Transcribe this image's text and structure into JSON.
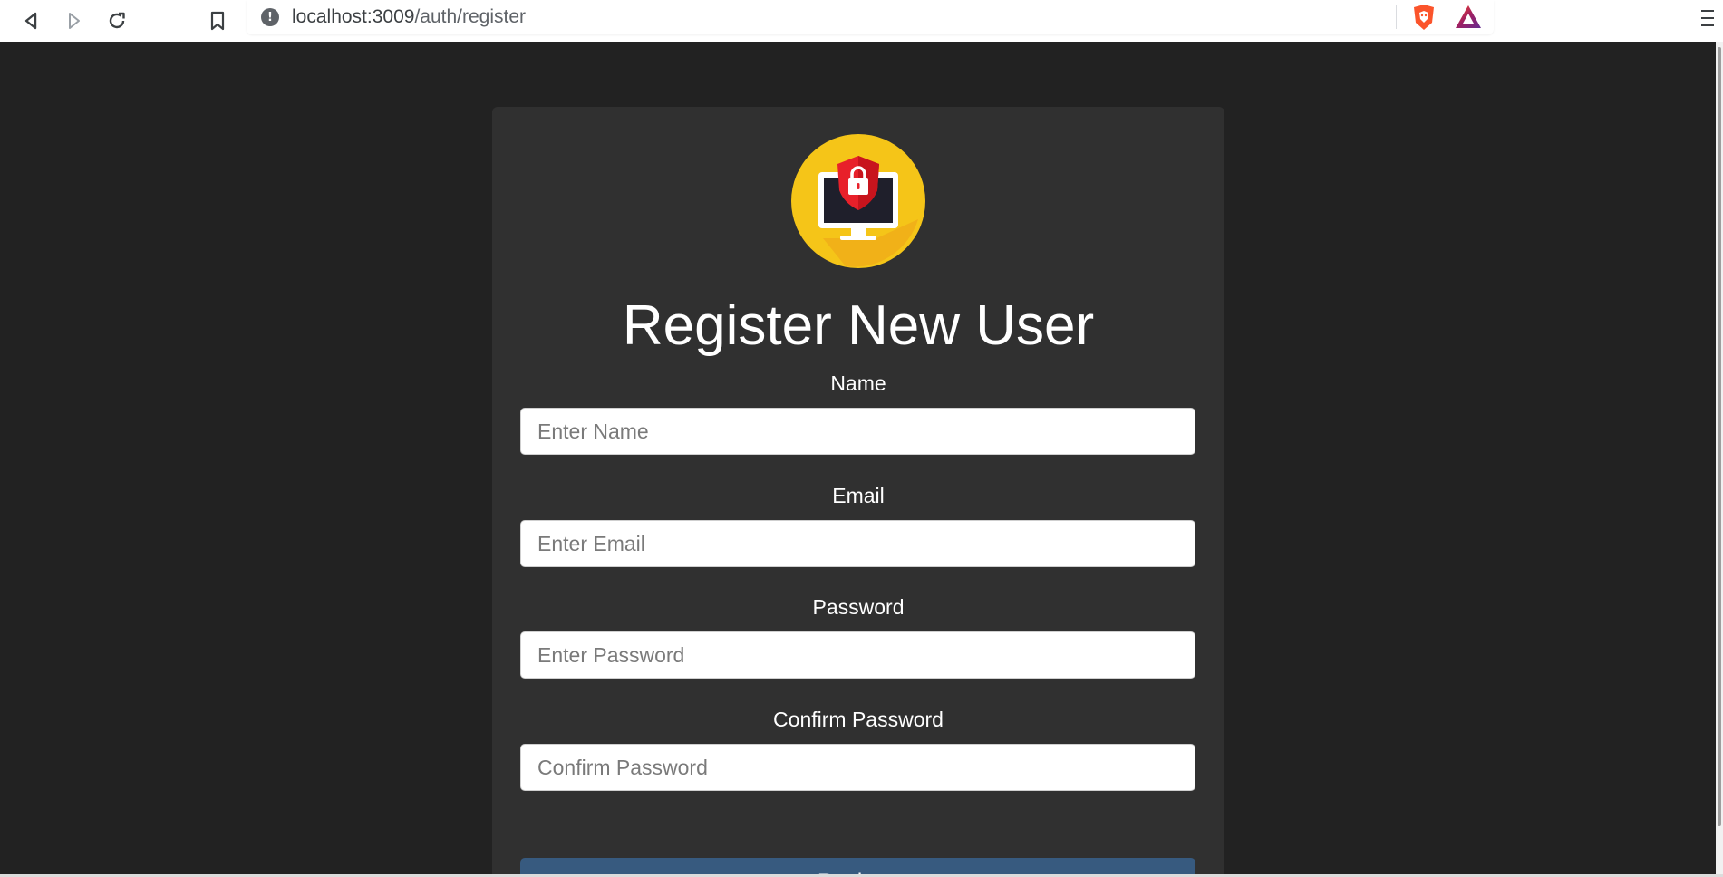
{
  "browser": {
    "url_host": "localhost:3009",
    "url_path": "/auth/register",
    "icons": {
      "back": "back-arrow-icon",
      "forward": "forward-arrow-icon",
      "reload": "reload-icon",
      "bookmark": "bookmark-icon",
      "site_info": "info-icon",
      "shield": "brave-shield-icon",
      "rewards": "brave-rewards-icon",
      "menu": "hamburger-menu-icon"
    },
    "site_info_glyph": "!"
  },
  "page": {
    "background": "#222222",
    "card_background": "#303030",
    "logo": {
      "icon": "security-lock-monitor-icon",
      "circle_color": "#f5c518",
      "shield_color": "#e8202a"
    },
    "title": "Register New User",
    "fields": [
      {
        "label": "Name",
        "placeholder": "Enter Name",
        "value": ""
      },
      {
        "label": "Email",
        "placeholder": "Enter Email",
        "value": ""
      },
      {
        "label": "Password",
        "placeholder": "Enter Password",
        "value": ""
      },
      {
        "label": "Confirm Password",
        "placeholder": "Confirm Password",
        "value": ""
      }
    ],
    "submit_label": "Register",
    "submit_color": "#375a7f"
  }
}
